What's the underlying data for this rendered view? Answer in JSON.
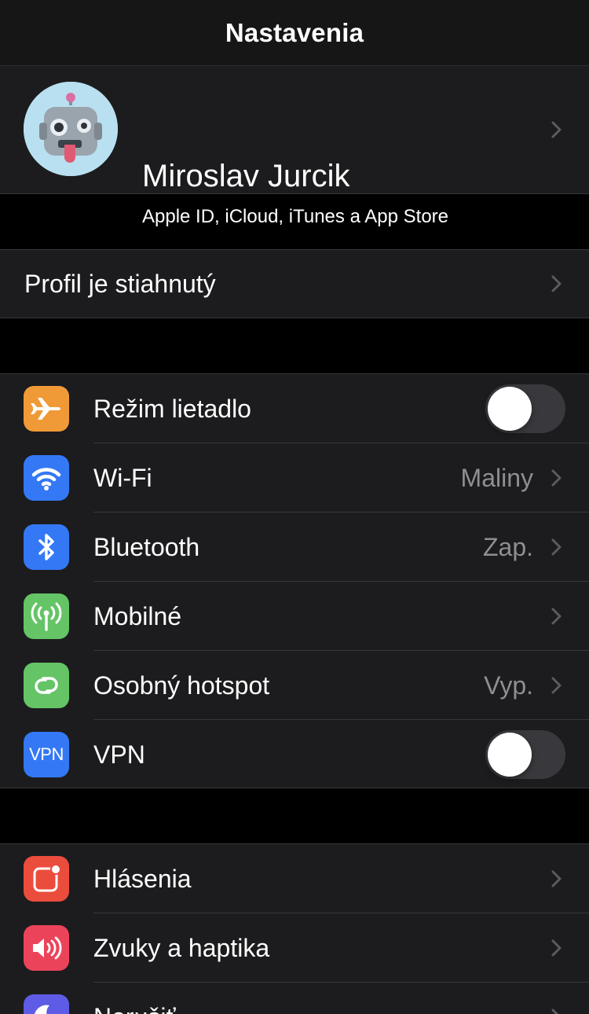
{
  "navbar": {
    "title": "Nastavenia"
  },
  "profile": {
    "name": "Miroslav Jurcik",
    "subtitle": "Apple ID, iCloud, iTunes a App Store"
  },
  "profile_downloaded": {
    "label": "Profil je stiahnutý"
  },
  "connectivity": [
    {
      "label": "Režim lietadlo",
      "icon": "airplane-icon",
      "color": "#f09a37",
      "toggle": false
    },
    {
      "label": "Wi-Fi",
      "icon": "wifi-icon",
      "color": "#3478f6",
      "value": "Maliny"
    },
    {
      "label": "Bluetooth",
      "icon": "bluetooth-icon",
      "color": "#3478f6",
      "value": "Zap."
    },
    {
      "label": "Mobilné",
      "icon": "cellular-antenna-icon",
      "color": "#65c466"
    },
    {
      "label": "Osobný hotspot",
      "icon": "hotspot-icon",
      "color": "#65c466",
      "value": "Vyp."
    },
    {
      "label": "VPN",
      "icon": "vpn-icon",
      "icon_text": "VPN",
      "color": "#3478f6",
      "toggle": false
    }
  ],
  "notifications": [
    {
      "label": "Hlásenia",
      "icon": "notifications-icon",
      "color": "#eb4d3d"
    },
    {
      "label": "Zvuky a haptika",
      "icon": "speaker-icon",
      "color": "#eb445a"
    },
    {
      "label": "Nerušiť",
      "icon": "moon-icon",
      "color": "#5e5ce6"
    }
  ],
  "colors": {
    "background": "#000000",
    "cell": "#1c1c1e",
    "separator": "#38383a",
    "secondary_text": "#8e8e93"
  }
}
